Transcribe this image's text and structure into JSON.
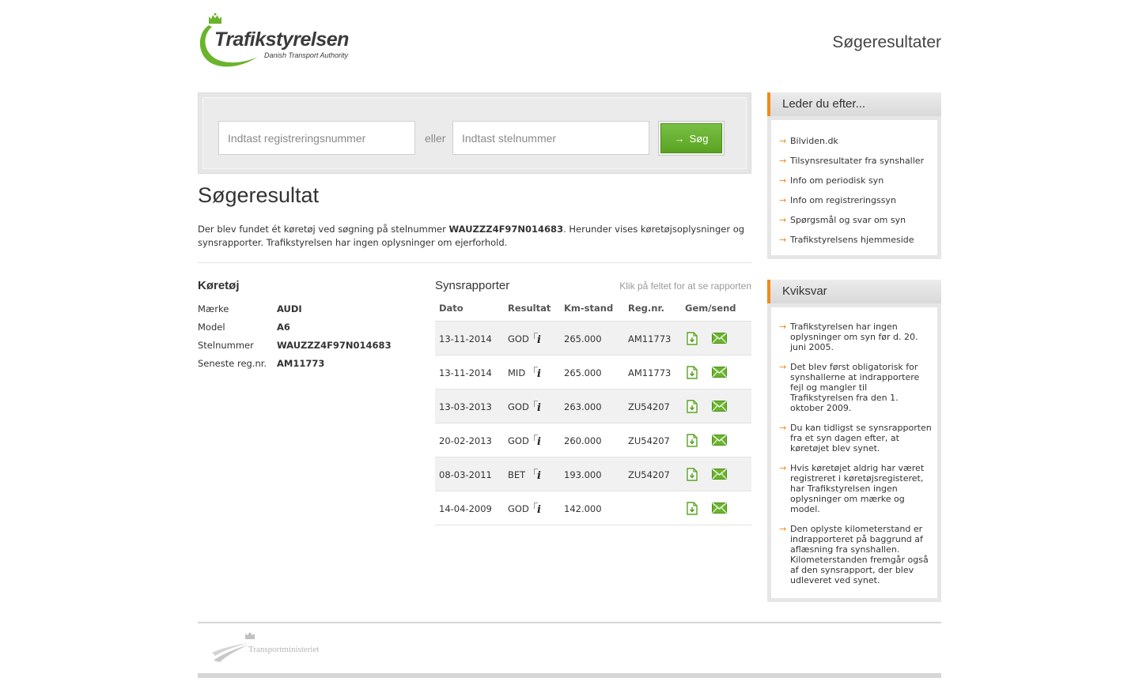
{
  "header": {
    "logo_name": "Trafikstyrelsen",
    "logo_sub": "Danish Transport Authority",
    "page_heading": "Søgeresultater"
  },
  "search": {
    "reg_placeholder": "Indtast registreringsnummer",
    "or_label": "eller",
    "stel_placeholder": "Indtast stelnummer",
    "button_label": "Søg"
  },
  "result": {
    "title": "Søgeresultat",
    "text_before": "Der blev fundet ét køretøj ved søgning på stelnummer ",
    "vin": "WAUZZZ4F97N014683",
    "text_after": ". Herunder vises køretøjsoplysninger og synsrapporter. Trafikstyrelsen har ingen oplysninger om ejerforhold."
  },
  "vehicle": {
    "title": "Køretøj",
    "rows": [
      {
        "label": "Mærke",
        "value": "AUDI"
      },
      {
        "label": "Model",
        "value": "A6"
      },
      {
        "label": "Stelnummer",
        "value": "WAUZZZ4F97N014683"
      },
      {
        "label": "Seneste reg.nr.",
        "value": "AM11773"
      }
    ]
  },
  "reports": {
    "title": "Synsrapporter",
    "hint": "Klik på feltet for at se rapporten",
    "columns": [
      "Dato",
      "Resultat",
      "Km-stand",
      "Reg.nr.",
      "Gem/send"
    ],
    "rows": [
      {
        "date": "13-11-2014",
        "result": "GOD",
        "km": "265.000",
        "reg": "AM11773"
      },
      {
        "date": "13-11-2014",
        "result": "MID",
        "km": "265.000",
        "reg": "AM11773"
      },
      {
        "date": "13-03-2013",
        "result": "GOD",
        "km": "263.000",
        "reg": "ZU54207"
      },
      {
        "date": "20-02-2013",
        "result": "GOD",
        "km": "260.000",
        "reg": "ZU54207"
      },
      {
        "date": "08-03-2011",
        "result": "BET",
        "km": "193.000",
        "reg": "ZU54207"
      },
      {
        "date": "14-04-2009",
        "result": "GOD",
        "km": "142.000",
        "reg": ""
      }
    ]
  },
  "sidebar": {
    "links_title": "Leder du efter...",
    "links": [
      "Bilviden.dk",
      "Tilsynsresultater fra synshaller",
      "Info om periodisk syn",
      "Info om registreringssyn",
      "Spørgsmål og svar om syn",
      "Trafikstyrelsens hjemmeside"
    ],
    "faq_title": "Kviksvar",
    "faq": [
      "Trafikstyrelsen har ingen oplysninger om syn før d. 20. juni 2005.",
      "Det blev først obligatorisk for synshallerne at indrapportere fejl og mangler til Trafikstyrelsen fra den 1. oktober 2009.",
      "Du kan tidligst se synsrapporten fra et syn dagen efter, at køretøjet blev synet.",
      "Hvis køretøjet aldrig har været registreret i køretøjsregisteret, har Trafikstyrelsen ingen oplysninger om mærke og model.",
      "Den oplyste kilometerstand er indrapporteret på baggrund af aflæsning fra synshallen. Kilometerstanden fremgår også af den synsrapport, der blev udleveret ved synet."
    ]
  },
  "footer": {
    "ministry": "Transportministeriet"
  },
  "colors": {
    "brand_green": "#6ab42d",
    "accent_orange": "#f18a1c"
  }
}
